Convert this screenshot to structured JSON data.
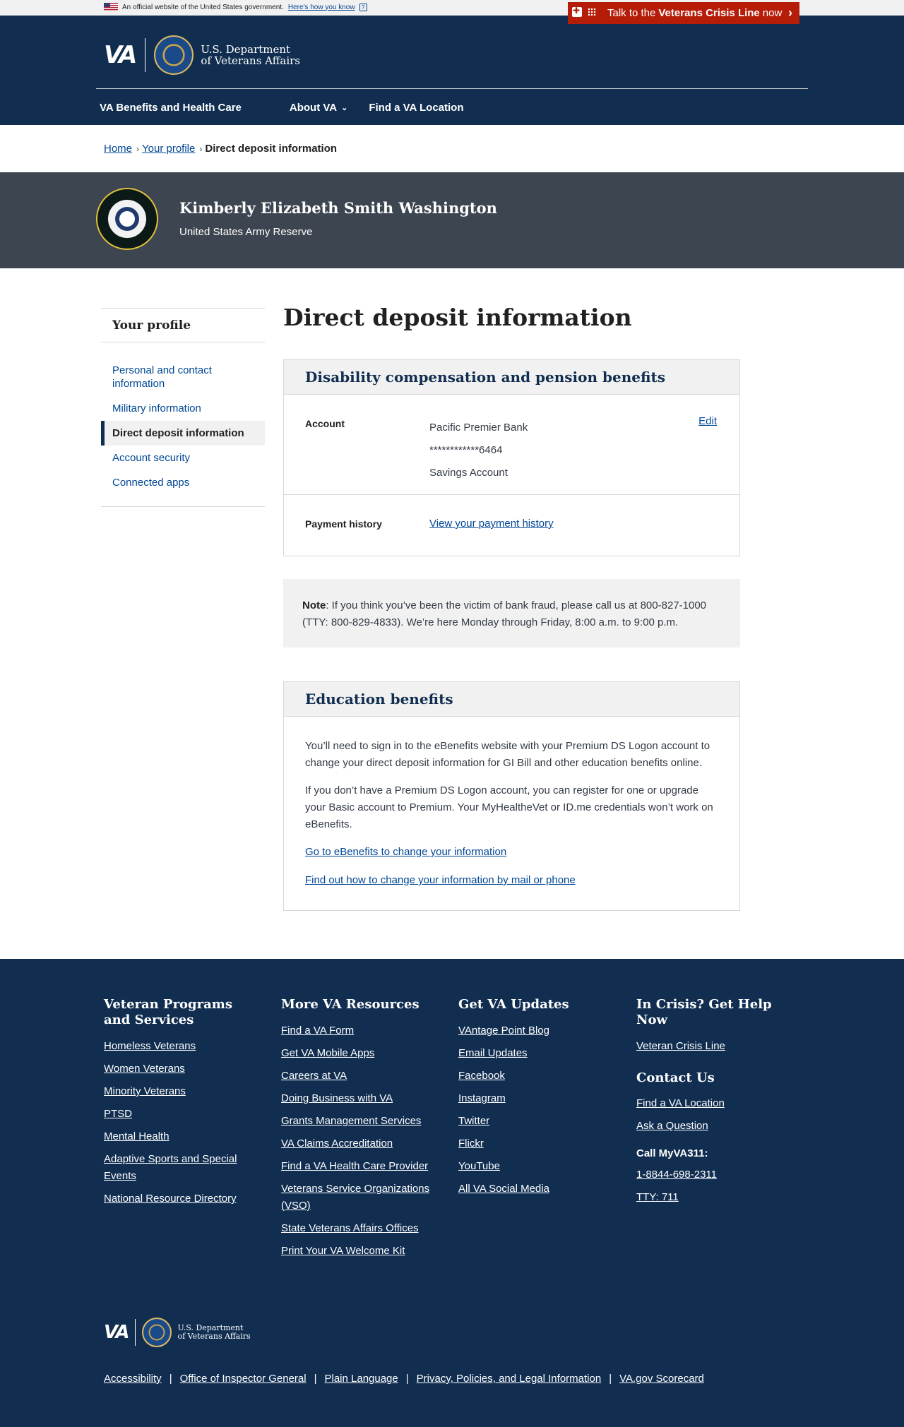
{
  "official_banner": {
    "text": "An official website of the United States government.",
    "link": "Here's how you know",
    "help_glyph": "?"
  },
  "crisis": {
    "prefix": "Talk to the",
    "bold": "Veterans Crisis Line",
    "suffix": "now",
    "arrow": "›"
  },
  "header": {
    "logo_text": "VA",
    "dept_line1": "U.S. Department",
    "dept_line2": "of Veterans Affairs",
    "nav": [
      {
        "label": "VA Benefits and Health Care",
        "chev": ""
      },
      {
        "label": "About VA",
        "chev": "⌄"
      },
      {
        "label": "Find a VA Location",
        "chev": ""
      }
    ]
  },
  "breadcrumb": {
    "home": "Home",
    "profile": "Your profile",
    "sep": "›",
    "current": "Direct deposit information"
  },
  "profile": {
    "name": "Kimberly Elizabeth Smith Washington",
    "branch": "United States Army Reserve"
  },
  "sidenav": {
    "title": "Your profile",
    "items": [
      "Personal and contact information",
      "Military information",
      "Direct deposit information",
      "Account security",
      "Connected apps"
    ]
  },
  "page_title": "Direct deposit information",
  "disability_card": {
    "title": "Disability compensation and pension benefits",
    "account_label": "Account",
    "bank_name": "Pacific Premier Bank",
    "account_number": "************6464",
    "account_type": "Savings Account",
    "edit": "Edit",
    "payment_label": "Payment history",
    "payment_link": "View your payment history"
  },
  "note": {
    "label": "Note",
    "text": ": If you think you’ve been the victim of bank fraud, please call us at 800-827-1000 (TTY: 800-829-4833). We’re here Monday through Friday, 8:00 a.m. to 9:00 p.m."
  },
  "education_card": {
    "title": "Education benefits",
    "para1": "You’ll need to sign in to the eBenefits website with your Premium DS Logon account to change your direct deposit information for GI Bill and other education benefits online.",
    "para2": "If you don’t have a Premium DS Logon account, you can register for one or upgrade your Basic account to Premium.  Your MyHealtheVet or ID.me credentials won’t work on eBenefits.",
    "link1": "Go to eBenefits to change your information",
    "link2": "Find out how to change your information by mail or phone"
  },
  "footer": {
    "col1": {
      "title": "Veteran Programs and Services",
      "links": [
        "Homeless Veterans",
        "Women Veterans",
        "Minority Veterans",
        "PTSD",
        "Mental Health",
        "Adaptive Sports and Special Events",
        "National Resource Directory"
      ]
    },
    "col2": {
      "title": "More VA Resources",
      "links": [
        "Find a VA Form",
        "Get VA Mobile Apps",
        "Careers at VA",
        "Doing Business with VA",
        "Grants Management Services",
        "VA Claims Accreditation",
        "Find a VA Health Care Provider",
        "Veterans Service Organizations (VSO)",
        "State Veterans Affairs Offices",
        "Print Your VA Welcome Kit"
      ]
    },
    "col3": {
      "title": "Get VA Updates",
      "links": [
        "VAntage Point Blog",
        "Email Updates",
        "Facebook",
        "Instagram",
        "Twitter",
        "Flickr",
        "YouTube",
        "All VA Social Media"
      ]
    },
    "col4": {
      "title": "In Crisis? Get Help Now",
      "crisis_link": "Veteran Crisis Line",
      "contact_title": "Contact Us",
      "contact_links": [
        "Find a VA Location",
        "Ask a Question"
      ],
      "call_title": "Call MyVA311:",
      "phone": "1-8844-698-2311",
      "tty": "TTY: 711"
    },
    "logo_text": "VA",
    "dept_line1": "U.S. Department",
    "dept_line2": "of Veterans Affairs",
    "bottom_links": [
      "Accessibility",
      "Office of Inspector General",
      "Plain Language",
      "Privacy, Policies, and Legal Information",
      "VA.gov Scorecard"
    ],
    "separator": "|"
  },
  "colors": {
    "header_bg": "#112e51",
    "crisis_bg": "#b51d09",
    "profile_banner_bg": "#3d4551",
    "link": "#004795"
  }
}
